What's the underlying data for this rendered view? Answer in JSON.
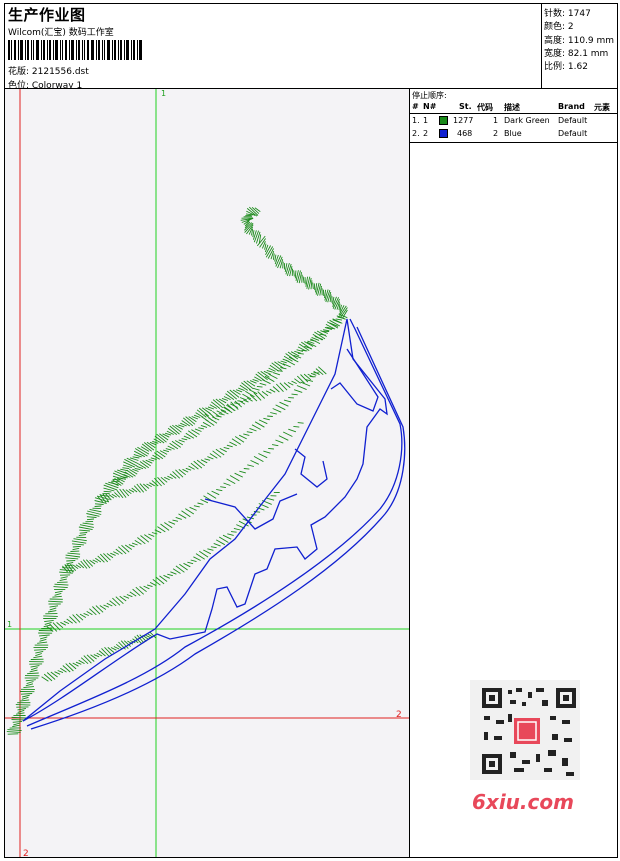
{
  "header": {
    "title": "生产作业图",
    "company": "Wilcom(汇宝) 数码工作室",
    "design_file": "花版: 2121556.dst",
    "colorway": "色位: Colorway 1"
  },
  "stats": {
    "stitches": "针数: 1747",
    "colors": "颜色: 2",
    "height": "高度: 110.9 mm",
    "width": "宽度: 82.1 mm",
    "scale": "比例: 1.62"
  },
  "sequence": {
    "title": "停止顺序:",
    "headers": {
      "num": "#",
      "no": "N#",
      "st": "St.",
      "code": "代码",
      "desc": "描述",
      "brand": "Brand",
      "elem": "元素"
    },
    "rows": [
      {
        "num": "1.",
        "no": "1",
        "st": "1277",
        "code": "1",
        "desc": "Dark Green",
        "brand": "Default",
        "color": "#1a8a1a"
      },
      {
        "num": "2.",
        "no": "2",
        "st": "468",
        "code": "2",
        "desc": "Blue",
        "brand": "Default",
        "color": "#1020d0"
      }
    ]
  },
  "canvas": {
    "axis_labels": {
      "top": "1",
      "left": "1",
      "right": "2",
      "bottom": "2"
    },
    "green_thread": "#1a8a1a",
    "blue_thread": "#1020d0",
    "guide_green": "#20d020",
    "guide_red": "#e02020"
  },
  "watermark": {
    "logo_text": "6xiu.com"
  }
}
